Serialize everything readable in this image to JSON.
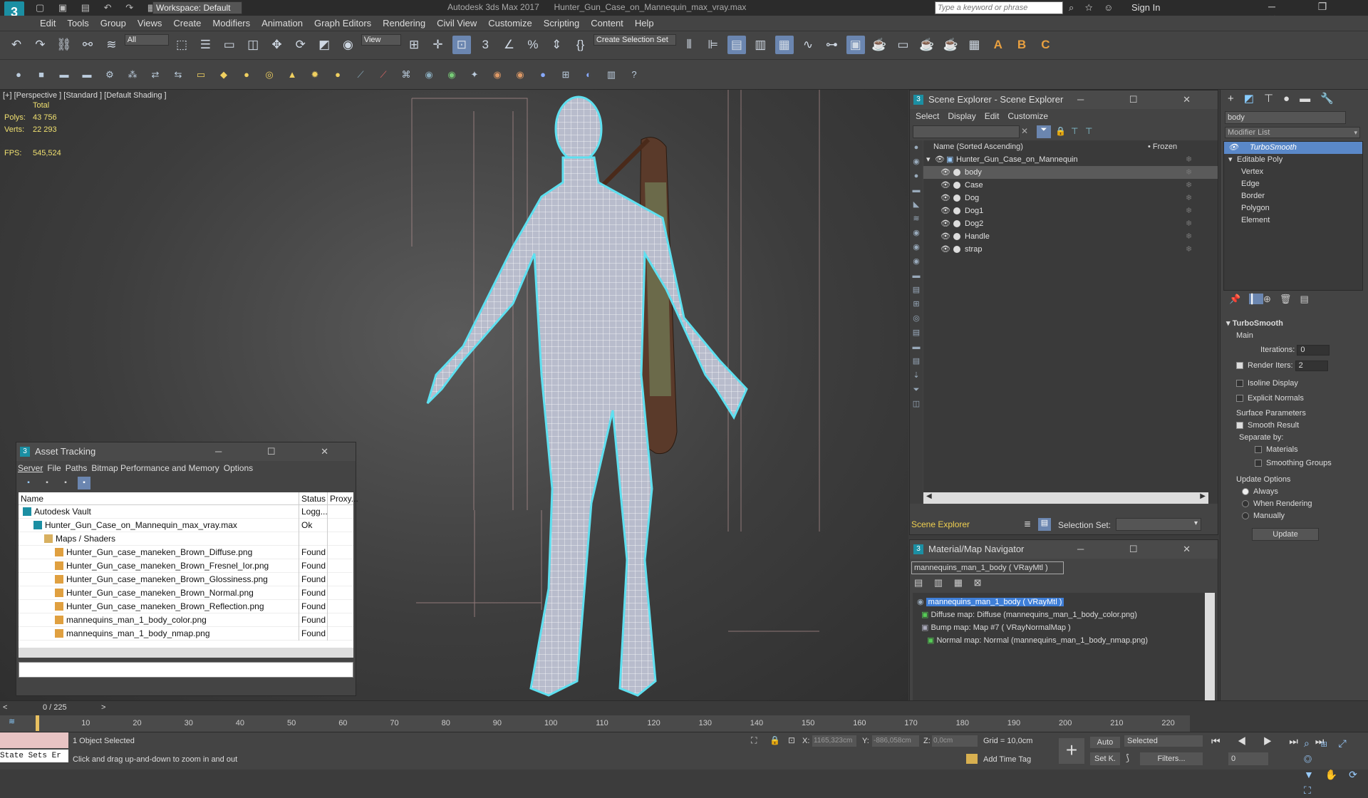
{
  "titlebar": {
    "workspace": "Workspace: Default",
    "app_title": "Autodesk 3ds Max 2017",
    "file_title": "Hunter_Gun_Case_on_Mannequin_max_vray.max",
    "search_placeholder": "Type a keyword or phrase",
    "sign_in": "Sign In"
  },
  "menu": [
    "Edit",
    "Tools",
    "Group",
    "Views",
    "Create",
    "Modifiers",
    "Animation",
    "Graph Editors",
    "Rendering",
    "Civil View",
    "Customize",
    "Scripting",
    "Content",
    "Help"
  ],
  "toolbar": {
    "filter_dropdown": "All",
    "view_dropdown": "View",
    "selection_set": "Create Selection Set"
  },
  "viewport": {
    "label": "[+] [Perspective ] [Standard ] [Default Shading ]",
    "stats_total": "Total",
    "polys_label": "Polys:",
    "polys_value": "43 756",
    "verts_label": "Verts:",
    "verts_value": "22 293",
    "fps_label": "FPS:",
    "fps_value": "545,524"
  },
  "asset_tracking": {
    "title": "Asset Tracking",
    "menu": [
      "Server",
      "File",
      "Paths",
      "Bitmap Performance and Memory",
      "Options"
    ],
    "columns": [
      "Name",
      "Status",
      "Proxy..."
    ],
    "rows": [
      {
        "name": "Autodesk Vault",
        "status": "Logg...",
        "indent": 0
      },
      {
        "name": "Hunter_Gun_Case_on_Mannequin_max_vray.max",
        "status": "Ok",
        "indent": 1
      },
      {
        "name": "Maps / Shaders",
        "status": "",
        "indent": 2
      },
      {
        "name": "Hunter_Gun_case_maneken_Brown_Diffuse.png",
        "status": "Found",
        "indent": 3
      },
      {
        "name": "Hunter_Gun_case_maneken_Brown_Fresnel_Ior.png",
        "status": "Found",
        "indent": 3
      },
      {
        "name": "Hunter_Gun_case_maneken_Brown_Glossiness.png",
        "status": "Found",
        "indent": 3
      },
      {
        "name": "Hunter_Gun_case_maneken_Brown_Normal.png",
        "status": "Found",
        "indent": 3
      },
      {
        "name": "Hunter_Gun_case_maneken_Brown_Reflection.png",
        "status": "Found",
        "indent": 3
      },
      {
        "name": "mannequins_man_1_body_color.png",
        "status": "Found",
        "indent": 3
      },
      {
        "name": "mannequins_man_1_body_nmap.png",
        "status": "Found",
        "indent": 3
      }
    ]
  },
  "scene_explorer": {
    "title": "Scene Explorer - Scene Explorer",
    "menu": [
      "Select",
      "Display",
      "Edit",
      "Customize"
    ],
    "col_name": "Name (Sorted Ascending)",
    "col_frozen": "• Frozen",
    "root": "Hunter_Gun_Case_on_Mannequin",
    "items": [
      "body",
      "Case",
      "Dog",
      "Dog1",
      "Dog2",
      "Handle",
      "strap"
    ],
    "footer_label": "Scene Explorer",
    "selection_set_label": "Selection Set:"
  },
  "material_navigator": {
    "title": "Material/Map Navigator",
    "current": "mannequins_man_1_body  ( VRayMtl )",
    "tree": [
      "mannequins_man_1_body  ( VRayMtl )",
      "Diffuse map: Diffuse (mannequins_man_1_body_color.png)",
      "Bump map: Map #7  ( VRayNormalMap )",
      "Normal map: Normal (mannequins_man_1_body_nmap.png)"
    ]
  },
  "command_panel": {
    "object_name": "body",
    "modifier_list": "Modifier List",
    "stack": [
      "TurboSmooth",
      "Editable Poly",
      "Vertex",
      "Edge",
      "Border",
      "Polygon",
      "Element"
    ],
    "rollout_title": "TurboSmooth",
    "main_label": "Main",
    "iterations_label": "Iterations:",
    "iterations_value": "0",
    "render_iters_label": "Render Iters:",
    "render_iters_value": "2",
    "isoline": "Isoline Display",
    "explicit_normals": "Explicit Normals",
    "surface_params": "Surface Parameters",
    "smooth_result": "Smooth Result",
    "separate_by": "Separate by:",
    "materials": "Materials",
    "smoothing_groups": "Smoothing Groups",
    "update_options": "Update Options",
    "always": "Always",
    "when_rendering": "When Rendering",
    "manually": "Manually",
    "update_button": "Update"
  },
  "timeline": {
    "frame_counter": "0 / 225",
    "ticks": [
      "10",
      "20",
      "30",
      "40",
      "50",
      "60",
      "70",
      "80",
      "90",
      "100",
      "110",
      "120",
      "130",
      "140",
      "150",
      "160",
      "170",
      "180",
      "190",
      "200",
      "210",
      "220"
    ]
  },
  "status": {
    "state_sets": "State Sets Er",
    "selected": "1 Object Selected",
    "hint": "Click and drag up-and-down to zoom in and out",
    "x_label": "X:",
    "x_value": "1165,323cm",
    "y_label": "Y:",
    "y_value": "-886,058cm",
    "z_label": "Z:",
    "z_value": "0,0cm",
    "grid": "Grid = 10,0cm",
    "add_time_tag": "Add Time Tag",
    "auto": "Auto",
    "selected_dropdown": "Selected",
    "set_k": "Set K.",
    "filters": "Filters...",
    "frame_value": "0"
  }
}
